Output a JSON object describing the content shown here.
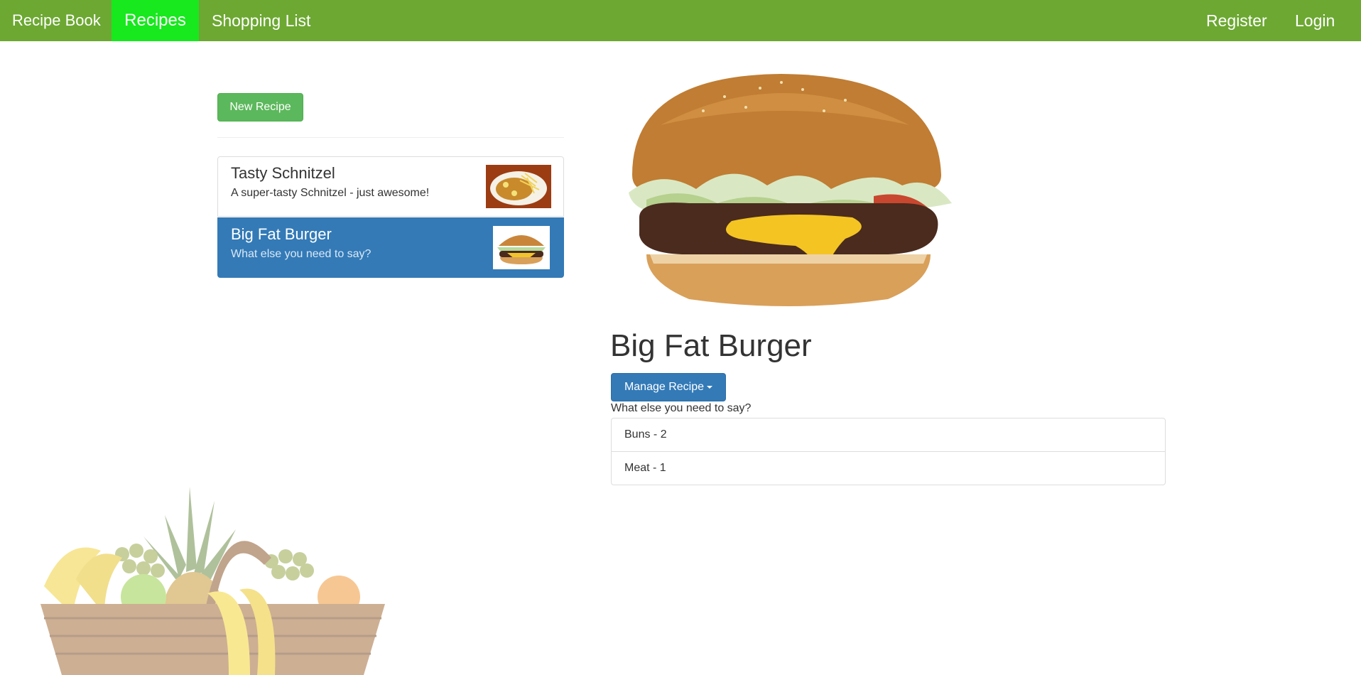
{
  "navbar": {
    "brand": "Recipe Book",
    "links": [
      "Recipes",
      "Shopping List"
    ],
    "right_links": [
      "Register",
      "Login"
    ],
    "active_color": "#18e81e",
    "bar_color": "#6ca832"
  },
  "sidebar": {
    "new_button": "New Recipe",
    "recipes": [
      {
        "name": "Tasty Schnitzel",
        "description": "A super-tasty Schnitzel - just awesome!",
        "image_icon": "schnitzel-image"
      },
      {
        "name": "Big Fat Burger",
        "description": "What else you need to say?",
        "image_icon": "burger-image",
        "active": true
      }
    ]
  },
  "detail": {
    "image_icon": "burger-image",
    "title": "Big Fat Burger",
    "manage_button": "Manage Recipe",
    "description": "What else you need to say?",
    "ingredients": [
      "Buns - 2",
      "Meat - 1"
    ]
  }
}
